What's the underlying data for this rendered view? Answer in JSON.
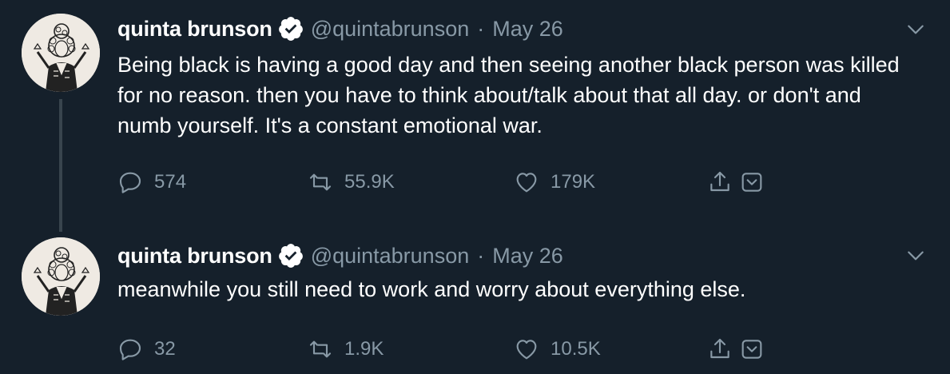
{
  "tweets": [
    {
      "display_name": "quinta brunson",
      "handle": "@quintabrunson",
      "separator": "·",
      "date": "May 26",
      "text": "Being black is having a good day and then seeing another black person was killed for no reason. then you have to think about/talk about that all day. or don't and numb yourself. It's a constant emotional war.",
      "replies": "574",
      "retweets": "55.9K",
      "likes": "179K"
    },
    {
      "display_name": "quinta brunson",
      "handle": "@quintabrunson",
      "separator": "·",
      "date": "May 26",
      "text": "meanwhile you still need to work and worry about everything else.",
      "replies": "32",
      "retweets": "1.9K",
      "likes": "10.5K"
    }
  ],
  "colors": {
    "background": "#15202b",
    "text_primary": "#ffffff",
    "text_secondary": "#8899a6",
    "thread_line": "#38444d",
    "verified_badge": "#ffffff"
  },
  "icons": [
    "verified-badge-icon",
    "chevron-down-icon",
    "reply-icon",
    "retweet-icon",
    "like-icon",
    "share-icon",
    "add-to-bookmarks-icon"
  ]
}
